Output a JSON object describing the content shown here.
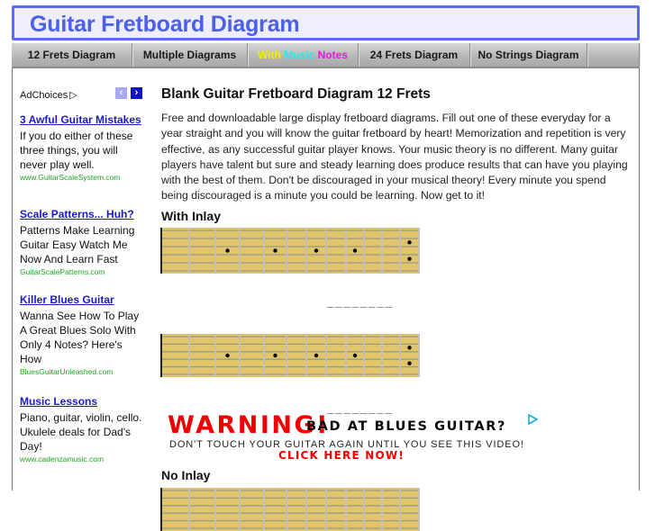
{
  "header": {
    "title": "Guitar Fretboard Diagram"
  },
  "nav": {
    "items": [
      {
        "label": "12 Frets Diagram"
      },
      {
        "label": "Multiple Diagrams"
      },
      {
        "label_parts": [
          "With",
          "Music",
          "Notes"
        ]
      },
      {
        "label": "24 Frets Diagram"
      },
      {
        "label": "No Strings Diagram"
      },
      {
        "label": ""
      }
    ],
    "colors": {
      "with": "#f4f000",
      "music": "#2ce6f0",
      "notes": "#f010e8"
    }
  },
  "sidebar": {
    "adchoices_label": "AdChoices",
    "adchoices_icon": "play-triangle-icon",
    "prev_icon": "‹",
    "next_icon": "›",
    "ads": [
      {
        "title": "3 Awful Guitar Mistakes",
        "body": "If you do either of these three things, you will never play well.",
        "url": "www.GuitarScaleSystem.com"
      },
      {
        "title": "Scale Patterns... Huh?",
        "body": "Patterns Make Learning Guitar Easy Watch Me Now And Learn Fast",
        "url": "GuitarScalePatterns.com"
      },
      {
        "title": "Killer Blues Guitar",
        "body": "Wanna See How To Play A Great Blues Solo With Only 4 Notes? Here's How",
        "url": "BluesGuitarUnleashed.com"
      },
      {
        "title": "Music Lessons",
        "body": "Piano, guitar, violin, cello. Ukulele deals for Dad's Day!",
        "url": "www.cadenzamusic.com"
      }
    ]
  },
  "main": {
    "title": "Blank Guitar Fretboard Diagram 12 Frets",
    "intro": "Free and downloadable large display fretboard diagrams. Fill out one of these everyday for a year straight and you will know the guitar fretboard by heart! Memorization and repetition is very effective, as any successful guitar player knows. Your music theory is no different. Many guitar players have talent but sure and steady learning does produce results that can have you playing with the best of them. Don't be discouraged in your musical theory! Every minute you spend being discouraged is a minute you could be learning. Now get to it!",
    "with_inlay_title": "With Inlay",
    "no_inlay_title": "No Inlay",
    "separator": "________",
    "fretboard": {
      "frets": 12,
      "strings": 6,
      "single_inlay_frets": [
        3,
        5,
        7,
        9
      ],
      "double_inlay_frets": [
        12
      ],
      "wood_color": "#e1c56a",
      "string_color": "#9a9a8a",
      "fret_color": "#c8bfb8",
      "nut_color": "#222222",
      "dot_color": "#000000"
    }
  },
  "banner": {
    "warning": "WARNING!",
    "headline": "BAD AT BLUES GUITAR?",
    "subline": "DON'T TOUCH YOUR GUITAR AGAIN UNTIL YOU SEE THIS VIDEO!",
    "cta": "CLICK HERE NOW!"
  }
}
